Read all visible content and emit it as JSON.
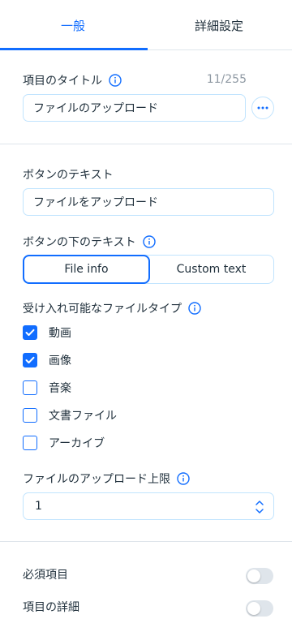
{
  "tabs": {
    "general": "一般",
    "advanced": "詳細設定"
  },
  "field_title": {
    "label": "項目のタイトル",
    "counter": "11/255",
    "value": "ファイルのアップロード"
  },
  "button_text": {
    "label": "ボタンのテキスト",
    "value": "ファイルをアップロード"
  },
  "below_button_text": {
    "label": "ボタンの下のテキスト",
    "options": [
      "File info",
      "Custom text"
    ],
    "selected": "File info"
  },
  "file_types": {
    "label": "受け入れ可能なファイルタイプ",
    "items": [
      {
        "label": "動画",
        "checked": true
      },
      {
        "label": "画像",
        "checked": true
      },
      {
        "label": "音楽",
        "checked": false
      },
      {
        "label": "文書ファイル",
        "checked": false
      },
      {
        "label": "アーカイブ",
        "checked": false
      }
    ]
  },
  "upload_limit": {
    "label": "ファイルのアップロード上限",
    "value": "1"
  },
  "toggles": [
    {
      "label": "必須項目",
      "on": false
    },
    {
      "label": "項目の詳細",
      "on": false
    }
  ],
  "colors": {
    "accent": "#116dff",
    "border": "#c1e4fe",
    "divider": "#dfe5eb",
    "text": "#20303c",
    "muted": "#8f99a3"
  },
  "icons": {
    "info": "info-icon",
    "more": "more-icon",
    "check": "check-icon",
    "stepper": "chevron-up-down-icon"
  }
}
